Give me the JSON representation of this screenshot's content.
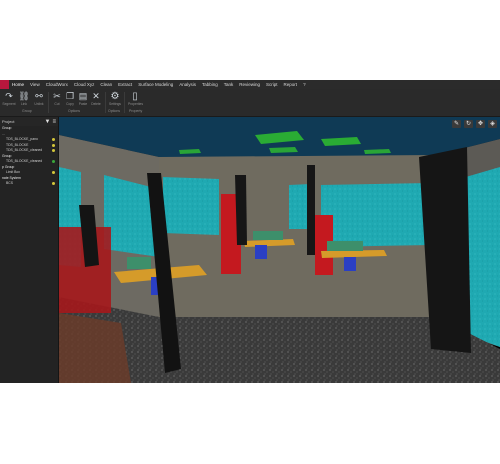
{
  "menu": {
    "items": [
      "Home",
      "View",
      "CloudWorx",
      "Cloud Xyz",
      "Clean",
      "Extract",
      "Surface Modeling",
      "Analysis",
      "Tabbing",
      "Tank",
      "Reviewing",
      "Script",
      "Report",
      "?"
    ]
  },
  "ribbon": {
    "tools": [
      {
        "label": "Segment",
        "icon": "redo-arrow-icon"
      },
      {
        "label": "Link",
        "icon": "link-icon"
      },
      {
        "label": "Unlink",
        "icon": "unlink-icon"
      },
      {
        "label": "Cut",
        "icon": "scissors-icon"
      },
      {
        "label": "Copy",
        "icon": "copy-icon"
      },
      {
        "label": "Paste",
        "icon": "paste-icon"
      },
      {
        "label": "Delete",
        "icon": "delete-icon"
      }
    ],
    "settings_label": "Settings",
    "properties_label": "Properties",
    "groups": [
      "Group",
      "Options",
      "Options",
      "Property"
    ]
  },
  "panel": {
    "title": "Project",
    "items": [
      {
        "label": "Group",
        "type": "group",
        "indent": false,
        "dot": ""
      },
      {
        "label": "...",
        "type": "item",
        "indent": false,
        "dot": ""
      },
      {
        "label": "TDS_BLOCKE_pano",
        "type": "item",
        "indent": true,
        "dot": "yellow"
      },
      {
        "label": "TDS_BLOCKE",
        "type": "item",
        "indent": true,
        "dot": "yellow"
      },
      {
        "label": "TDS_BLOCKE_cleaned",
        "type": "item",
        "indent": true,
        "dot": "yellow"
      },
      {
        "label": "Group",
        "type": "group",
        "indent": false,
        "dot": ""
      },
      {
        "label": "TDS_BLOCKE_cleaned",
        "type": "item",
        "indent": true,
        "dot": "green"
      },
      {
        "label": "p Group",
        "type": "group",
        "indent": false,
        "dot": ""
      },
      {
        "label": "Limit Box",
        "type": "item",
        "indent": true,
        "dot": "yellow"
      },
      {
        "label": "nate System",
        "type": "group",
        "indent": false,
        "dot": ""
      },
      {
        "label": "BCS",
        "type": "item",
        "indent": true,
        "dot": "yellow"
      }
    ]
  },
  "viewport": {
    "background": "#000000"
  }
}
